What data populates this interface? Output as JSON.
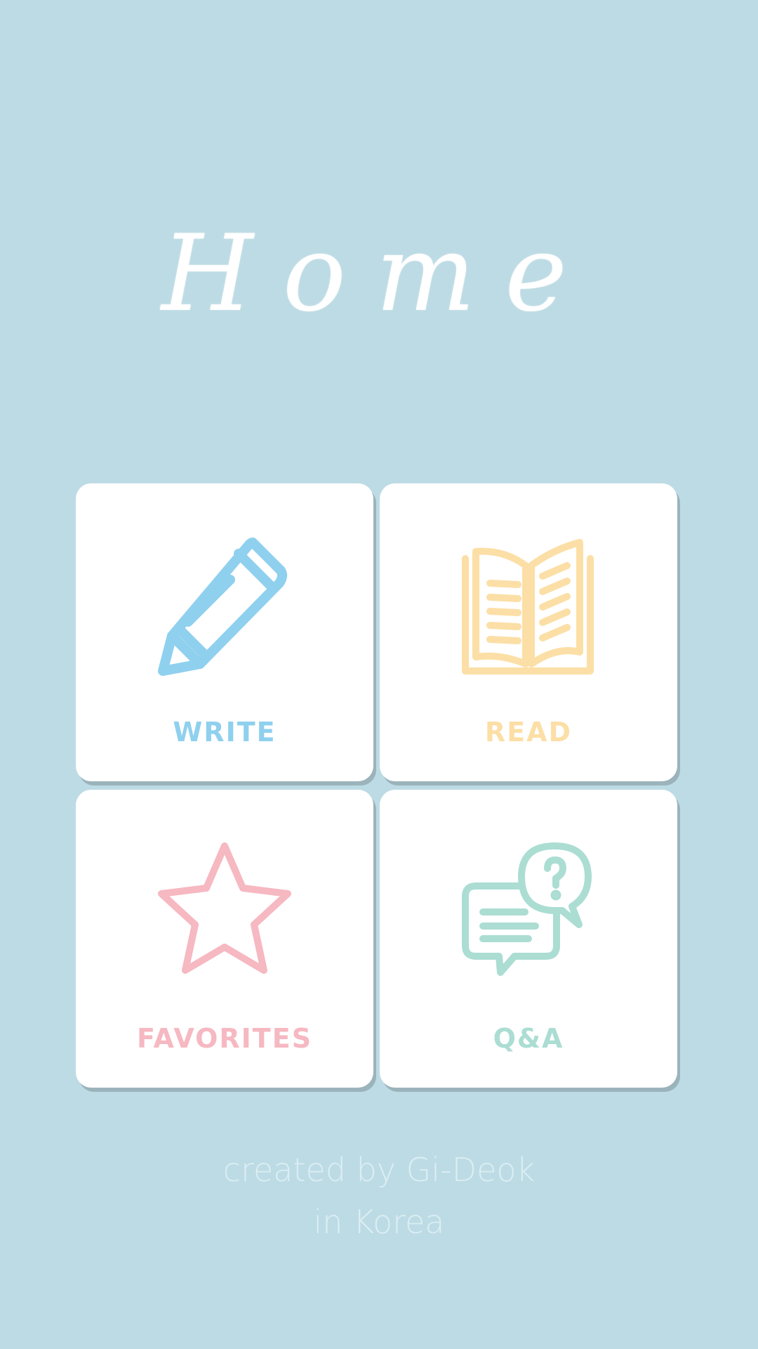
{
  "title": "Home",
  "menu": [
    {
      "key": "write",
      "label": "WRITE",
      "icon": "pencil-icon",
      "color": "#8fd0ee"
    },
    {
      "key": "read",
      "label": "READ",
      "icon": "open-book-icon",
      "color": "#fcdfa6"
    },
    {
      "key": "favorites",
      "label": "FAVORITES",
      "icon": "star-icon",
      "color": "#f6b8c1"
    },
    {
      "key": "qa",
      "label": "Q&A",
      "icon": "chat-bubbles-icon",
      "color": "#abddd3"
    }
  ],
  "footer": {
    "line1": "created by Gi-Deok",
    "line2": "in Korea"
  },
  "colors": {
    "background": "#bddbe4",
    "card": "#ffffff",
    "title": "#ffffff"
  }
}
